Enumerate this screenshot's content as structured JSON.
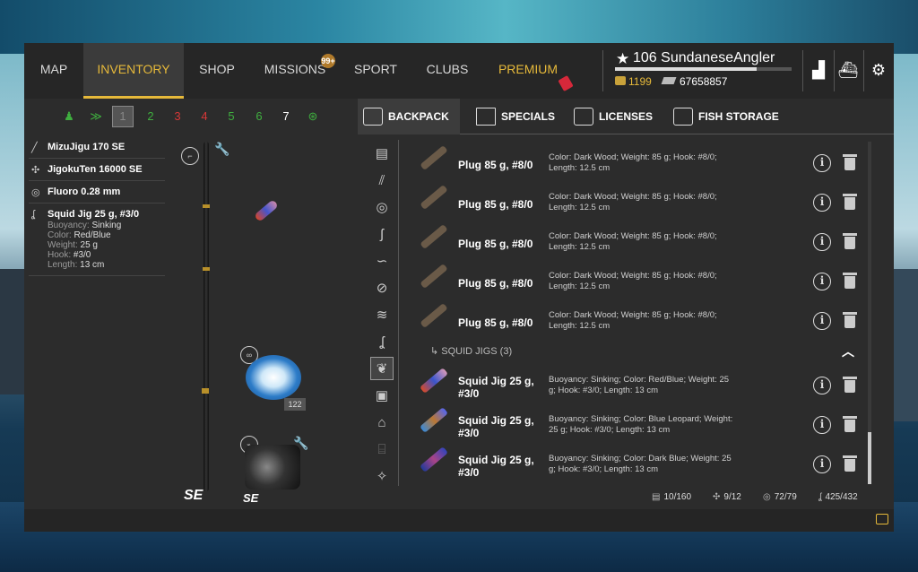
{
  "nav": {
    "map": "MAP",
    "inventory": "INVENTORY",
    "shop": "SHOP",
    "missions": "MISSIONS",
    "missions_badge": "99+",
    "sport": "SPORT",
    "clubs": "CLUBS",
    "premium": "PREMIUM"
  },
  "player": {
    "level_name": "106 SundaneseAngler",
    "gold": "1199",
    "silver": "67658857",
    "xp_fraction": 0.8
  },
  "rod_slots": [
    "1",
    "2",
    "3",
    "4",
    "5",
    "6",
    "7"
  ],
  "equipment": {
    "rod": "MizuJigu 170 SE",
    "reel": "JigokuTen 16000 SE",
    "line": "Fluoro 0.28 mm",
    "lure": "Squid Jig 25 g, #3/0",
    "lure_details": [
      {
        "label": "Buoyancy:",
        "value": "Sinking"
      },
      {
        "label": "Color:",
        "value": "Red/Blue"
      },
      {
        "label": "Weight:",
        "value": "25 g"
      },
      {
        "label": "Hook:",
        "value": "#3/0"
      },
      {
        "label": "Length:",
        "value": "13 cm"
      }
    ],
    "line_count": "122",
    "rod_logo": "SE",
    "reel_logo": "SE"
  },
  "tabs": {
    "backpack": "BACKPACK",
    "specials": "SPECIALS",
    "licenses": "LICENSES",
    "fish_storage": "FISH STORAGE"
  },
  "items": [
    {
      "name": "Plug 85 g, #8/0",
      "desc": "Color: Dark Wood; Weight: 85 g; Hook: #8/0; Length: 12.5 cm"
    },
    {
      "name": "Plug 85 g, #8/0",
      "desc": "Color: Dark Wood; Weight: 85 g; Hook: #8/0; Length: 12.5 cm"
    },
    {
      "name": "Plug 85 g, #8/0",
      "desc": "Color: Dark Wood; Weight: 85 g; Hook: #8/0; Length: 12.5 cm"
    },
    {
      "name": "Plug 85 g, #8/0",
      "desc": "Color: Dark Wood; Weight: 85 g; Hook: #8/0; Length: 12.5 cm"
    },
    {
      "name": "Plug 85 g, #8/0",
      "desc": "Color: Dark Wood; Weight: 85 g; Hook: #8/0; Length: 12.5 cm"
    }
  ],
  "group": {
    "label": "SQUID JIGS (3)"
  },
  "jigs": [
    {
      "name": "Squid Jig 25 g, #3/0",
      "desc": "Buoyancy: Sinking; Color: Red/Blue; Weight: 25 g; Hook: #3/0; Length: 13 cm"
    },
    {
      "name": "Squid Jig 25 g, #3/0",
      "desc": "Buoyancy: Sinking; Color: Blue Leopard; Weight: 25 g; Hook: #3/0; Length: 13 cm"
    },
    {
      "name": "Squid Jig 25 g, #3/0",
      "desc": "Buoyancy: Sinking; Color: Dark Blue; Weight: 25 g; Hook: #3/0; Length: 13 cm"
    }
  ],
  "stats": {
    "backpack": "10/160",
    "reels": "9/12",
    "lines": "72/79",
    "lures": "425/432"
  }
}
